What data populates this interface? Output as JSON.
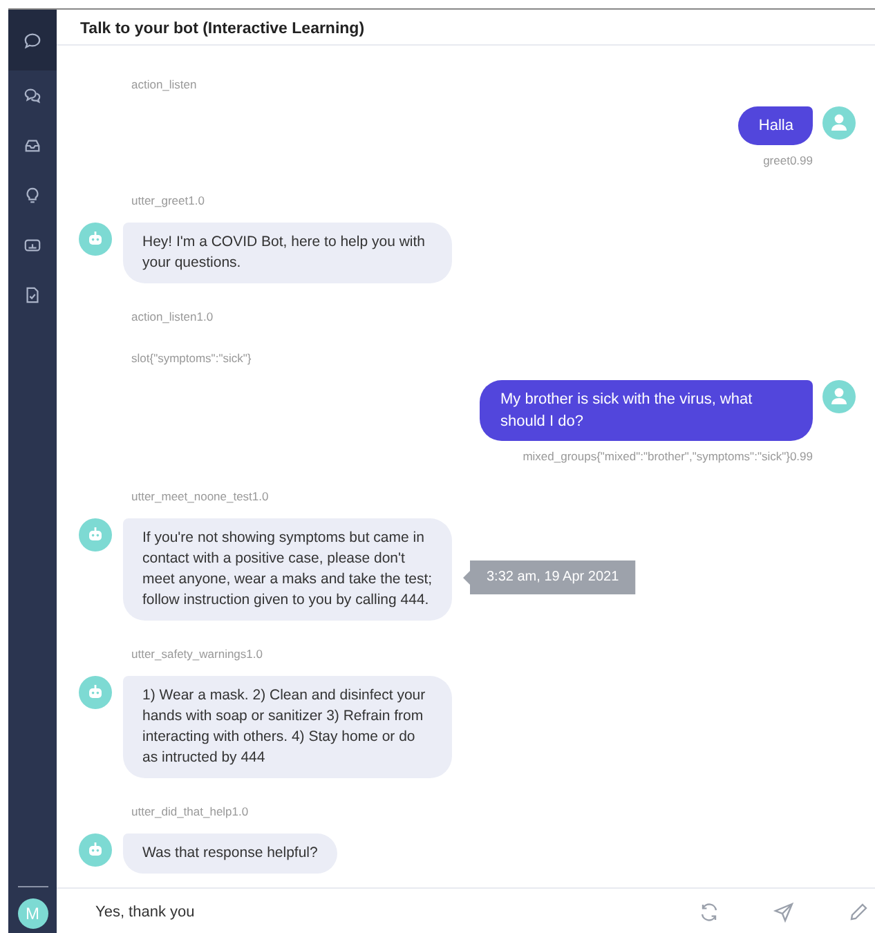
{
  "sidebar": {
    "items": [
      {
        "selected": true
      },
      {
        "selected": false
      },
      {
        "selected": false
      },
      {
        "selected": false
      },
      {
        "selected": false
      },
      {
        "selected": false
      }
    ],
    "user_initial": "M"
  },
  "header": {
    "title": "Talk to your bot (Interactive Learning)"
  },
  "messages": [
    {
      "kind": "label",
      "text": "action_listen"
    },
    {
      "kind": "user",
      "text": "Halla",
      "caption": "greet0.99"
    },
    {
      "kind": "label",
      "text": "utter_greet1.0"
    },
    {
      "kind": "bot",
      "text": "Hey! I'm a COVID Bot, here to help you with your questions."
    },
    {
      "kind": "label",
      "text": "action_listen1.0"
    },
    {
      "kind": "label",
      "text": "slot{\"symptoms\":\"sick\"}"
    },
    {
      "kind": "user",
      "text": "My brother is sick with the virus, what should I do?",
      "caption": "mixed_groups{\"mixed\":\"brother\",\"symptoms\":\"sick\"}0.99"
    },
    {
      "kind": "label",
      "text": "utter_meet_noone_test1.0"
    },
    {
      "kind": "bot",
      "text": "If you're not showing symptoms but came in contact with a positive case, please don't meet anyone, wear a maks and take the test; follow instruction given to you by calling 444.",
      "timestamp": "3:32 am, 19 Apr 2021"
    },
    {
      "kind": "label",
      "text": "utter_safety_warnings1.0"
    },
    {
      "kind": "bot",
      "text": "1) Wear a mask. 2) Clean and disinfect your hands with soap or sanitizer 3) Refrain from interacting with others. 4) Stay home or do as intructed by 444"
    },
    {
      "kind": "label",
      "text": "utter_did_that_help1.0"
    },
    {
      "kind": "bot",
      "text": "Was that response helpful?"
    }
  ],
  "input": {
    "value": "Yes, thank you"
  }
}
